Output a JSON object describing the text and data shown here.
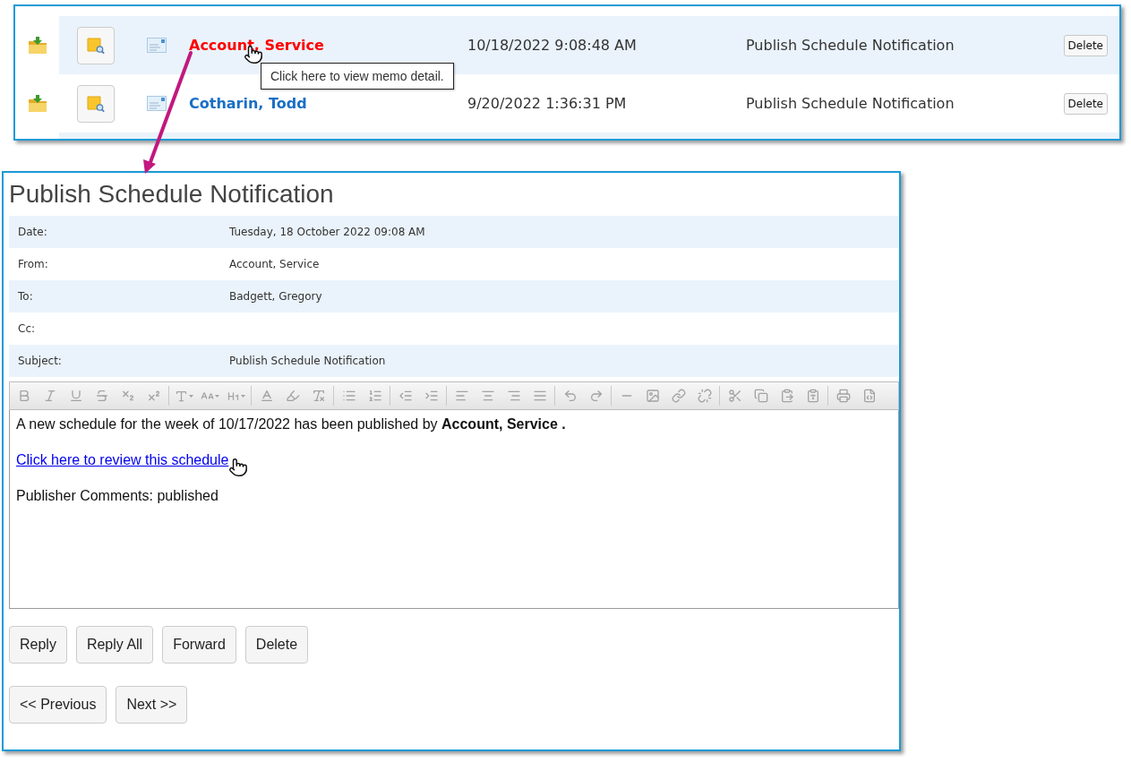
{
  "memo_list": {
    "rows": [
      {
        "sender": "Account, Service",
        "hovered": true,
        "received": "10/18/2022 9:08:48 AM",
        "subject": "Publish Schedule Notification",
        "delete_label": "Delete"
      },
      {
        "sender": "Cotharin, Todd",
        "hovered": false,
        "received": "9/20/2022 1:36:31 PM",
        "subject": "Publish Schedule Notification",
        "delete_label": "Delete"
      }
    ]
  },
  "tooltip": {
    "text": "Click here to view memo detail."
  },
  "memo_detail": {
    "title": "Publish Schedule Notification",
    "fields": [
      {
        "label": "Date:",
        "value": "Tuesday, 18 October 2022 09:08 AM"
      },
      {
        "label": "From:",
        "value": "Account, Service"
      },
      {
        "label": "To:",
        "value": "Badgett, Gregory"
      },
      {
        "label": "Cc:"
      },
      {
        "label": "Subject:",
        "value": "Publish Schedule Notification"
      }
    ],
    "editor": {
      "toolbar": {
        "disabled": true,
        "groups": [
          {
            "buttons": [
              {
                "kind": "bold"
              },
              {
                "kind": "italic"
              },
              {
                "kind": "underline"
              },
              {
                "kind": "strikethrough"
              },
              {
                "kind": "subscript"
              },
              {
                "kind": "superscript"
              }
            ]
          },
          {
            "buttons": [
              {
                "kind": "font"
              },
              {
                "kind": "font-size"
              },
              {
                "kind": "heading"
              }
            ]
          },
          {
            "buttons": [
              {
                "kind": "text-color"
              },
              {
                "kind": "highlight"
              },
              {
                "kind": "clear-format"
              }
            ]
          },
          {
            "buttons": [
              {
                "kind": "bulleted-list"
              },
              {
                "kind": "numbered-list"
              }
            ]
          },
          {
            "buttons": [
              {
                "kind": "outdent"
              },
              {
                "kind": "indent"
              }
            ]
          },
          {
            "buttons": [
              {
                "kind": "align-left"
              },
              {
                "kind": "align-center"
              },
              {
                "kind": "align-right"
              },
              {
                "kind": "justify"
              }
            ]
          },
          {
            "buttons": [
              {
                "kind": "undo"
              },
              {
                "kind": "redo"
              }
            ]
          },
          {
            "buttons": [
              {
                "kind": "horizontal-rule"
              },
              {
                "kind": "image"
              },
              {
                "kind": "link"
              },
              {
                "kind": "unlink"
              }
            ]
          },
          {
            "buttons": [
              {
                "kind": "cut"
              },
              {
                "kind": "copy"
              },
              {
                "kind": "paste"
              },
              {
                "kind": "paste-text"
              }
            ]
          },
          {
            "buttons": [
              {
                "kind": "print"
              },
              {
                "kind": "source"
              }
            ]
          }
        ]
      },
      "paragraphs": [
        {
          "kind": "text",
          "text": "A new schedule for the week of 10/17/2022 has been published by **Account, Service .**"
        },
        {
          "kind": "link",
          "text": "Click here to review this schedule"
        },
        {
          "kind": "text",
          "text": "Publisher Comments: published"
        }
      ]
    },
    "actions": [
      "Reply",
      "Reply All",
      "Forward",
      "Delete"
    ],
    "navigation": [
      "<< Previous",
      "Next >>"
    ]
  }
}
